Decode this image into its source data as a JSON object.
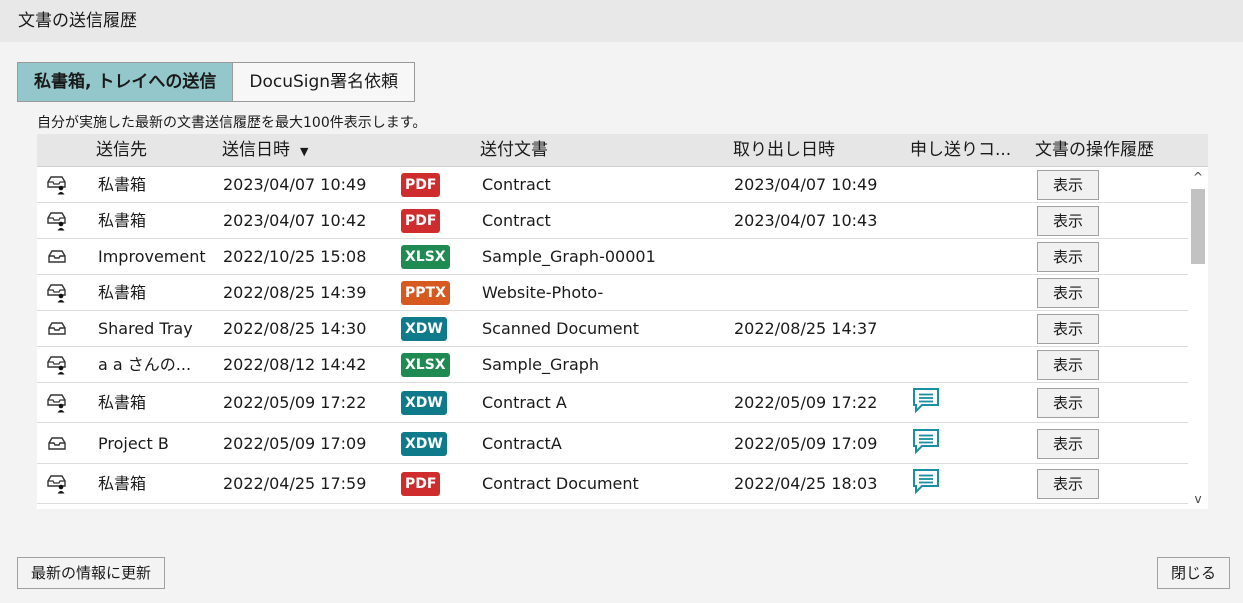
{
  "window": {
    "title": "文書の送信履歴"
  },
  "tabs": [
    {
      "label": "私書箱, トレイへの送信",
      "active": true
    },
    {
      "label": "DocuSign署名依頼",
      "active": false
    }
  ],
  "description": "自分が実施した最新の文書送信履歴を最大100件表示します。",
  "table": {
    "headers": {
      "recipient": "送信先",
      "sent_at": "送信日時",
      "sort_indicator": "▼",
      "document": "送付文書",
      "retrieved_at": "取り出し日時",
      "memo": "申し送りコ...",
      "history": "文書の操作履歴"
    },
    "rows": [
      {
        "icon": "mailbox-user-icon",
        "recipient": "私書箱",
        "sent_at": "2023/04/07 10:49",
        "type": "PDF",
        "document": "Contract",
        "retrieved_at": "2023/04/07 10:49",
        "memo": false,
        "view": "表示"
      },
      {
        "icon": "mailbox-user-icon",
        "recipient": "私書箱",
        "sent_at": "2023/04/07 10:42",
        "type": "PDF",
        "document": "Contract",
        "retrieved_at": "2023/04/07 10:43",
        "memo": false,
        "view": "表示"
      },
      {
        "icon": "tray-icon",
        "recipient": "Improvement",
        "sent_at": "2022/10/25 15:08",
        "type": "XLSX",
        "document": "Sample_Graph-00001",
        "retrieved_at": "",
        "memo": false,
        "view": "表示"
      },
      {
        "icon": "mailbox-user-icon",
        "recipient": "私書箱",
        "sent_at": "2022/08/25 14:39",
        "type": "PPTX",
        "document": "Website-Photo-",
        "retrieved_at": "",
        "memo": false,
        "view": "表示"
      },
      {
        "icon": "tray-icon",
        "recipient": "Shared Tray",
        "sent_at": "2022/08/25 14:30",
        "type": "XDW",
        "document": "Scanned Document",
        "retrieved_at": "2022/08/25 14:37",
        "memo": false,
        "view": "表示"
      },
      {
        "icon": "mailbox-user-icon",
        "recipient": "a a さんの...",
        "sent_at": "2022/08/12 14:42",
        "type": "XLSX",
        "document": "Sample_Graph",
        "retrieved_at": "",
        "memo": false,
        "view": "表示"
      },
      {
        "icon": "mailbox-user-icon",
        "recipient": "私書箱",
        "sent_at": "2022/05/09 17:22",
        "type": "XDW",
        "document": "Contract A",
        "retrieved_at": "2022/05/09 17:22",
        "memo": true,
        "view": "表示"
      },
      {
        "icon": "tray-icon",
        "recipient": "Project B",
        "sent_at": "2022/05/09 17:09",
        "type": "XDW",
        "document": "ContractA",
        "retrieved_at": "2022/05/09 17:09",
        "memo": true,
        "view": "表示"
      },
      {
        "icon": "mailbox-user-icon",
        "recipient": "私書箱",
        "sent_at": "2022/04/25 17:59",
        "type": "PDF",
        "document": "Contract Document",
        "retrieved_at": "2022/04/25 18:03",
        "memo": true,
        "view": "表示"
      }
    ]
  },
  "scrollbar": {
    "up": "^",
    "down": "v"
  },
  "footer": {
    "refresh_label": "最新の情報に更新",
    "close_label": "閉じる"
  },
  "colors": {
    "active_tab": "#93c7cb",
    "pdf": "#cf2d2d",
    "xlsx": "#1f8a52",
    "pptx": "#d65a1f",
    "xdw": "#0f7a8a",
    "memo": "#1a8fa3"
  }
}
